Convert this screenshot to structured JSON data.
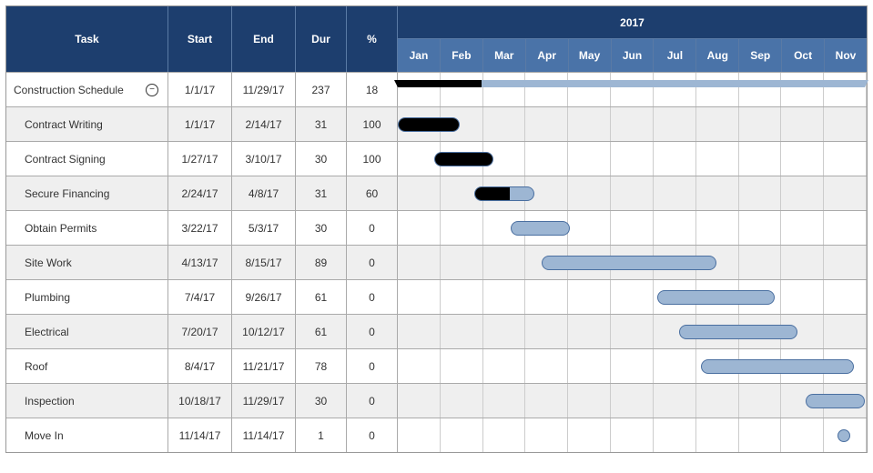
{
  "header": {
    "task": "Task",
    "start": "Start",
    "end": "End",
    "dur": "Dur",
    "pct": "%",
    "year": "2017"
  },
  "months": [
    "Jan",
    "Feb",
    "Mar",
    "Apr",
    "May",
    "Jun",
    "Jul",
    "Aug",
    "Sep",
    "Oct",
    "Nov"
  ],
  "rows": [
    {
      "name": "Construction Schedule",
      "start": "1/1/17",
      "end": "11/29/17",
      "dur": "237",
      "pct": "18",
      "type": "summary",
      "indent": 0
    },
    {
      "name": "Contract Writing",
      "start": "1/1/17",
      "end": "2/14/17",
      "dur": "31",
      "pct": "100",
      "type": "task",
      "indent": 1
    },
    {
      "name": "Contract Signing",
      "start": "1/27/17",
      "end": "3/10/17",
      "dur": "30",
      "pct": "100",
      "type": "task",
      "indent": 1
    },
    {
      "name": "Secure Financing",
      "start": "2/24/17",
      "end": "4/8/17",
      "dur": "31",
      "pct": "60",
      "type": "task",
      "indent": 1
    },
    {
      "name": "Obtain Permits",
      "start": "3/22/17",
      "end": "5/3/17",
      "dur": "30",
      "pct": "0",
      "type": "task",
      "indent": 1
    },
    {
      "name": "Site Work",
      "start": "4/13/17",
      "end": "8/15/17",
      "dur": "89",
      "pct": "0",
      "type": "task",
      "indent": 1
    },
    {
      "name": "Plumbing",
      "start": "7/4/17",
      "end": "9/26/17",
      "dur": "61",
      "pct": "0",
      "type": "task",
      "indent": 1
    },
    {
      "name": "Electrical",
      "start": "7/20/17",
      "end": "10/12/17",
      "dur": "61",
      "pct": "0",
      "type": "task",
      "indent": 1
    },
    {
      "name": "Roof",
      "start": "8/4/17",
      "end": "11/21/17",
      "dur": "78",
      "pct": "0",
      "type": "task",
      "indent": 1
    },
    {
      "name": "Inspection",
      "start": "10/18/17",
      "end": "11/29/17",
      "dur": "30",
      "pct": "0",
      "type": "task",
      "indent": 1
    },
    {
      "name": "Move In",
      "start": "11/14/17",
      "end": "11/14/17",
      "dur": "1",
      "pct": "0",
      "type": "milestone",
      "indent": 1
    }
  ],
  "chart_data": {
    "type": "gantt",
    "title": "Construction Schedule 2017",
    "xlabel": "2017",
    "time_axis": {
      "start": "2017-01-01",
      "end": "2017-11-30",
      "ticks": [
        "Jan",
        "Feb",
        "Mar",
        "Apr",
        "May",
        "Jun",
        "Jul",
        "Aug",
        "Sep",
        "Oct",
        "Nov"
      ]
    },
    "tasks": [
      {
        "name": "Construction Schedule",
        "start": "2017-01-01",
        "end": "2017-11-29",
        "duration_days": 237,
        "percent_complete": 18,
        "type": "summary"
      },
      {
        "name": "Contract Writing",
        "start": "2017-01-01",
        "end": "2017-02-14",
        "duration_days": 31,
        "percent_complete": 100,
        "type": "task"
      },
      {
        "name": "Contract Signing",
        "start": "2017-01-27",
        "end": "2017-03-10",
        "duration_days": 30,
        "percent_complete": 100,
        "type": "task"
      },
      {
        "name": "Secure Financing",
        "start": "2017-02-24",
        "end": "2017-04-08",
        "duration_days": 31,
        "percent_complete": 60,
        "type": "task"
      },
      {
        "name": "Obtain Permits",
        "start": "2017-03-22",
        "end": "2017-05-03",
        "duration_days": 30,
        "percent_complete": 0,
        "type": "task"
      },
      {
        "name": "Site Work",
        "start": "2017-04-13",
        "end": "2017-08-15",
        "duration_days": 89,
        "percent_complete": 0,
        "type": "task"
      },
      {
        "name": "Plumbing",
        "start": "2017-07-04",
        "end": "2017-09-26",
        "duration_days": 61,
        "percent_complete": 0,
        "type": "task"
      },
      {
        "name": "Electrical",
        "start": "2017-07-20",
        "end": "2017-10-12",
        "duration_days": 61,
        "percent_complete": 0,
        "type": "task"
      },
      {
        "name": "Roof",
        "start": "2017-08-04",
        "end": "2017-11-21",
        "duration_days": 78,
        "percent_complete": 0,
        "type": "task"
      },
      {
        "name": "Inspection",
        "start": "2017-10-18",
        "end": "2017-11-29",
        "duration_days": 30,
        "percent_complete": 0,
        "type": "task"
      },
      {
        "name": "Move In",
        "start": "2017-11-14",
        "end": "2017-11-14",
        "duration_days": 1,
        "percent_complete": 0,
        "type": "milestone"
      }
    ]
  }
}
